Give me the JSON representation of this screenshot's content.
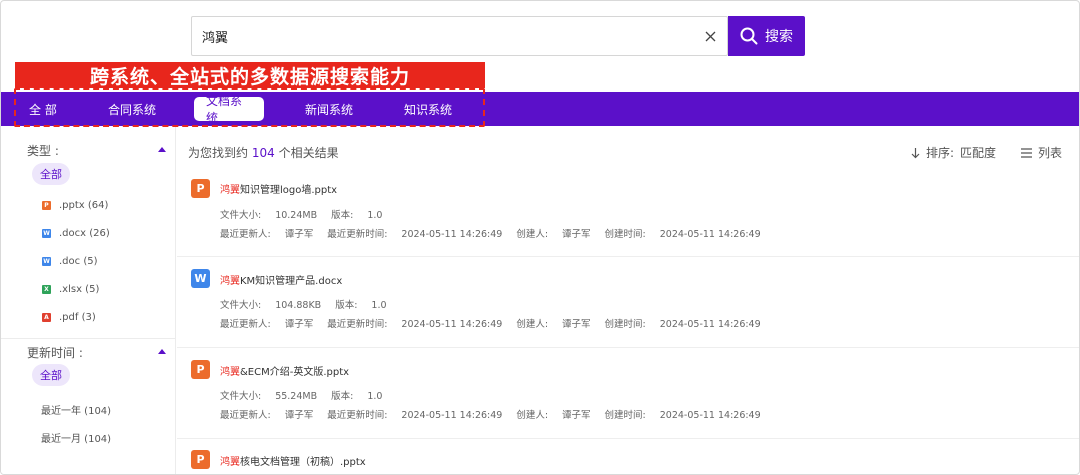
{
  "search": {
    "query": "鸿翼",
    "button_label": "搜索"
  },
  "banner": {
    "text": "跨系统、全站式的多数据源搜索能力"
  },
  "tabs": [
    {
      "label": "全 部"
    },
    {
      "label": "合同系统"
    },
    {
      "label": "文档系统",
      "active": true
    },
    {
      "label": "新闻系统"
    },
    {
      "label": "知识系统"
    }
  ],
  "sidebar": {
    "type_heading": "类型 :",
    "type_all": "全部",
    "types": [
      {
        "label": ".pptx (64)",
        "icon": "ppt-file-icon"
      },
      {
        "label": ".docx (26)",
        "icon": "word-file-icon"
      },
      {
        "label": ".doc (5)",
        "icon": "word-file-icon"
      },
      {
        "label": ".xlsx (5)",
        "icon": "excel-file-icon"
      },
      {
        "label": ".pdf (3)",
        "icon": "pdf-file-icon"
      }
    ],
    "time_heading": "更新时间 :",
    "time_all": "全部",
    "times": [
      {
        "label": "最近一年 (104)"
      },
      {
        "label": "最近一月 (104)"
      }
    ]
  },
  "results_header": {
    "prefix": "为您找到约",
    "count": "104",
    "suffix": "个相关结果",
    "sort_label": "排序:",
    "sort_value": "匹配度",
    "view_label": "列表"
  },
  "results": [
    {
      "icon_letter": "P",
      "highlight": "鸿翼",
      "title_rest": "知识管理logo墙.pptx",
      "size_label": "文件大小:",
      "size": "10.24MB",
      "version_label": "版本:",
      "version": "1.0",
      "updater_label": "最近更新人:",
      "updater": "谭子军",
      "updated_label": "最近更新时间:",
      "updated": "2024-05-11 14:26:49",
      "creator_label": "创建人:",
      "creator": "谭子军",
      "created_label": "创建时间:",
      "created": "2024-05-11 14:26:49"
    },
    {
      "icon_letter": "W",
      "highlight": "鸿翼",
      "title_rest": "KM知识管理产品.docx",
      "size_label": "文件大小:",
      "size": "104.88KB",
      "version_label": "版本:",
      "version": "1.0",
      "updater_label": "最近更新人:",
      "updater": "谭子军",
      "updated_label": "最近更新时间:",
      "updated": "2024-05-11 14:26:49",
      "creator_label": "创建人:",
      "creator": "谭子军",
      "created_label": "创建时间:",
      "created": "2024-05-11 14:26:49"
    },
    {
      "icon_letter": "P",
      "highlight": "鸿翼",
      "title_rest": "&ECM介绍-英文版.pptx",
      "size_label": "文件大小:",
      "size": "55.24MB",
      "version_label": "版本:",
      "version": "1.0",
      "updater_label": "最近更新人:",
      "updater": "谭子军",
      "updated_label": "最近更新时间:",
      "updated": "2024-05-11 14:26:49",
      "creator_label": "创建人:",
      "creator": "谭子军",
      "created_label": "创建时间:",
      "created": "2024-05-11 14:26:49"
    },
    {
      "icon_letter": "P",
      "highlight": "鸿翼",
      "title_rest": "核电文档管理（初稿）.pptx"
    }
  ],
  "colors": {
    "brand": "#5b10c9",
    "highlight": "#e8261c",
    "ppt": "#ec6c2c",
    "word": "#3e86ea",
    "excel": "#2fa35a",
    "pdf": "#e0402f"
  }
}
